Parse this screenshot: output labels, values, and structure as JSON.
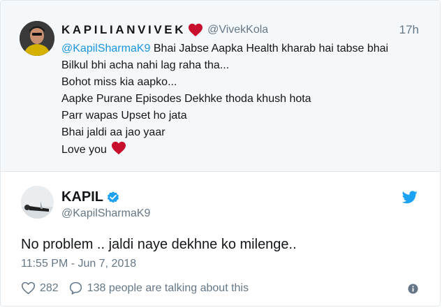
{
  "quoted": {
    "author_name": "KAPILIANVIVEK",
    "handle": "@VivekKola",
    "time": "17h",
    "mention": "@KapilSharmaK9",
    "first_line_rest": " Bhai Jabse Aapka Health kharab hai tabse bhai",
    "lines": [
      "Bilkul bhi acha nahi lag raha tha...",
      "Bohot miss kia aapko...",
      "Aapke Purane Episodes Dekhke thoda khush hota",
      "Parr wapas Upset ho jata",
      "Bhai jaldi aa jao yaar"
    ],
    "last_line": "Love you",
    "heart_color": "#c8102e",
    "avatar_icon": "person-avatar"
  },
  "tweet": {
    "author_name": "KAPIL",
    "handle": "@KapilSharmaK9",
    "text": "No problem .. jaldi naye dekhne ko milenge..",
    "time": "11:55 PM - Jun 7, 2018",
    "likes": "282",
    "conversation": "138 people are talking about this",
    "verified_color": "#1da1f2",
    "brand_color": "#1da1f2",
    "icons": [
      "verified-badge-icon",
      "twitter-bird-icon",
      "heart-icon",
      "comment-icon",
      "info-icon"
    ]
  }
}
